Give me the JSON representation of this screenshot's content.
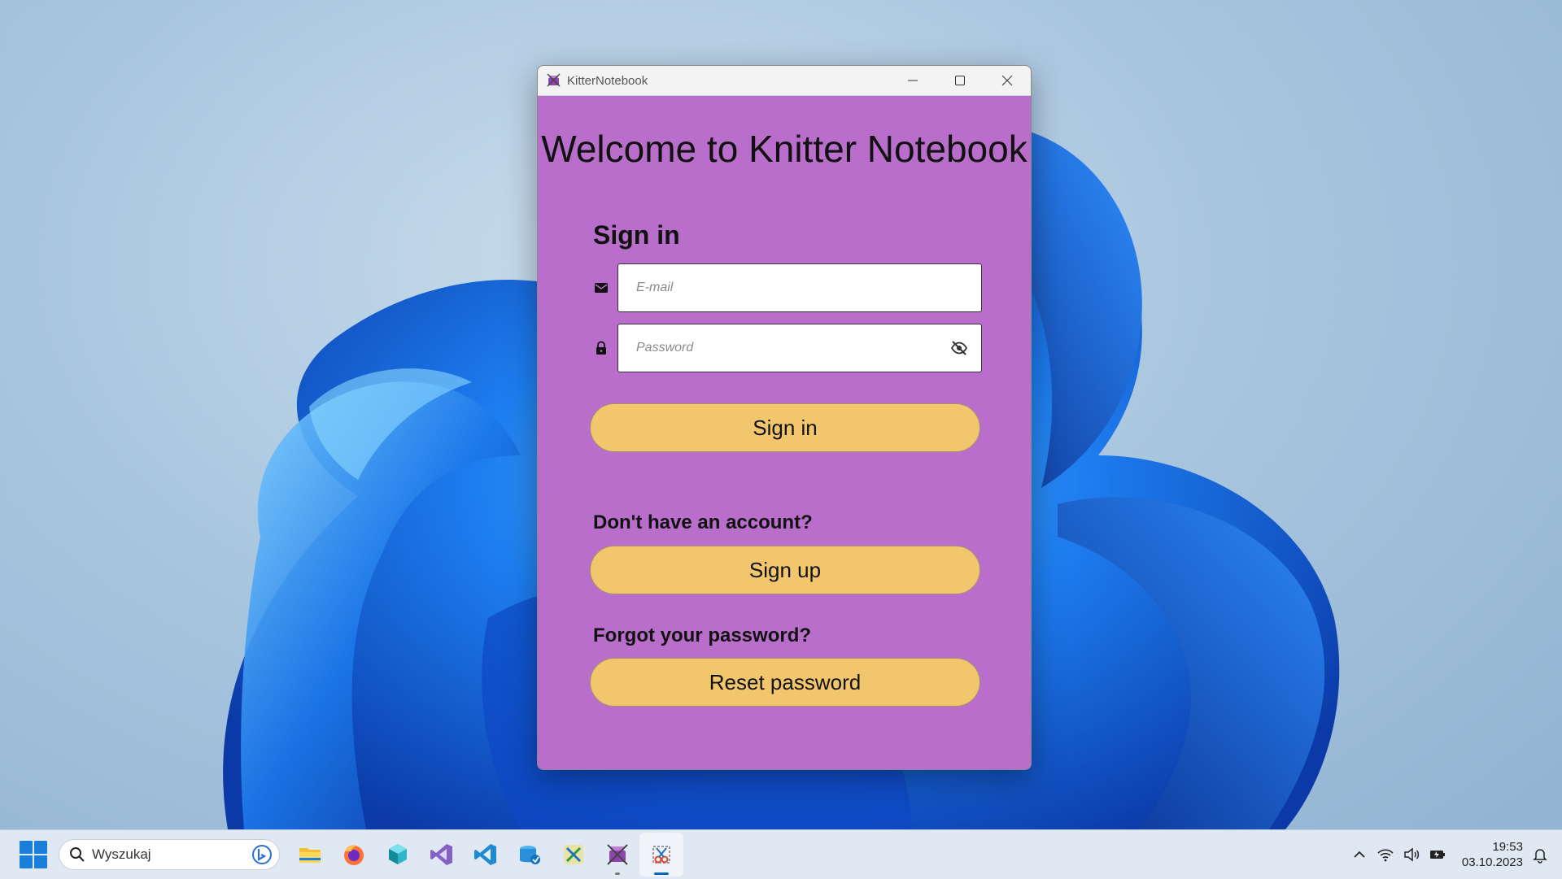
{
  "window": {
    "title": "KitterNotebook",
    "controls": {
      "minimize": "minimize",
      "maximize": "maximize",
      "close": "close"
    }
  },
  "login": {
    "welcome": "Welcome to Knitter Notebook",
    "signin_heading": "Sign in",
    "email_placeholder": "E-mail",
    "password_placeholder": "Password",
    "signin_button": "Sign in",
    "no_account_text": "Don't have an account?",
    "signup_button": "Sign up",
    "forgot_text": "Forgot your password?",
    "reset_button": "Reset password"
  },
  "colors": {
    "window_bg": "#b96ecb",
    "button_bg": "#f1c66c",
    "accent": "#0067c0"
  },
  "taskbar": {
    "search_placeholder": "Wyszukaj",
    "apps": [
      "file-explorer-icon",
      "firefox-icon",
      "app-icon",
      "visual-studio-icon",
      "vscode-icon",
      "azure-icon",
      "tool-icon",
      "knitter-notebook-icon",
      "snipping-tool-icon"
    ],
    "time": "19:53",
    "date": "03.10.2023"
  }
}
